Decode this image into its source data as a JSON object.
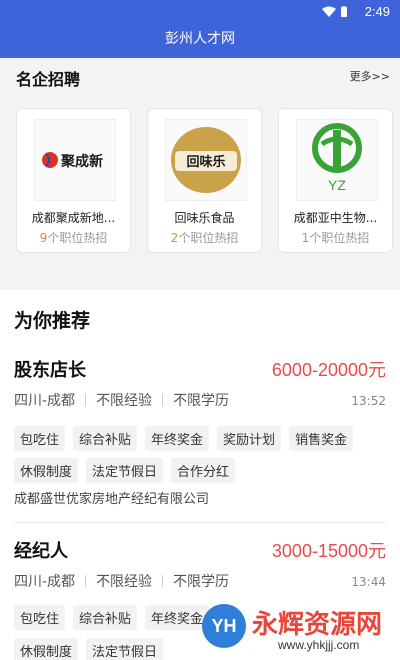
{
  "status": {
    "time": "2:49"
  },
  "app": {
    "title": "彭州人才网"
  },
  "featured": {
    "title": "名企招聘",
    "more": "更多>>",
    "companies": [
      {
        "name": "成都聚成新地...",
        "count": "9",
        "suffix": "个职位热招",
        "logo_text": "聚成新"
      },
      {
        "name": "回味乐食品",
        "count": "2",
        "suffix": "个职位热招",
        "logo_text": "回味乐"
      },
      {
        "name": "成都亚中生物...",
        "count": "1",
        "suffix": "个职位热招",
        "logo_text": "YZ"
      }
    ]
  },
  "recommend": {
    "title": "为你推荐",
    "jobs": [
      {
        "title": "股东店长",
        "salary": "6000-20000元",
        "location": "四川-成都",
        "experience": "不限经验",
        "education": "不限学历",
        "time": "13:52",
        "tags_row1": [
          "包吃住",
          "综合补贴",
          "年终奖金",
          "奖励计划",
          "销售奖金"
        ],
        "tags_row2": [
          "休假制度",
          "法定节假日",
          "合作分红"
        ],
        "company": "成都盛世优家房地产经纪有限公司"
      },
      {
        "title": "经纪人",
        "salary": "3000-15000元",
        "location": "四川-成都",
        "experience": "不限经验",
        "education": "不限学历",
        "time": "13:44",
        "tags_row1": [
          "包吃住",
          "综合补贴",
          "年终奖金"
        ],
        "tags_row2": [
          "休假制度",
          "法定节假日"
        ]
      }
    ]
  },
  "watermark": {
    "badge": "YH",
    "text": "永辉资源网",
    "url": "www.yhkjjj.com"
  },
  "colors": {
    "primary": "#3f63d8",
    "salary": "#e84b4b",
    "count": "#e58a2b"
  }
}
